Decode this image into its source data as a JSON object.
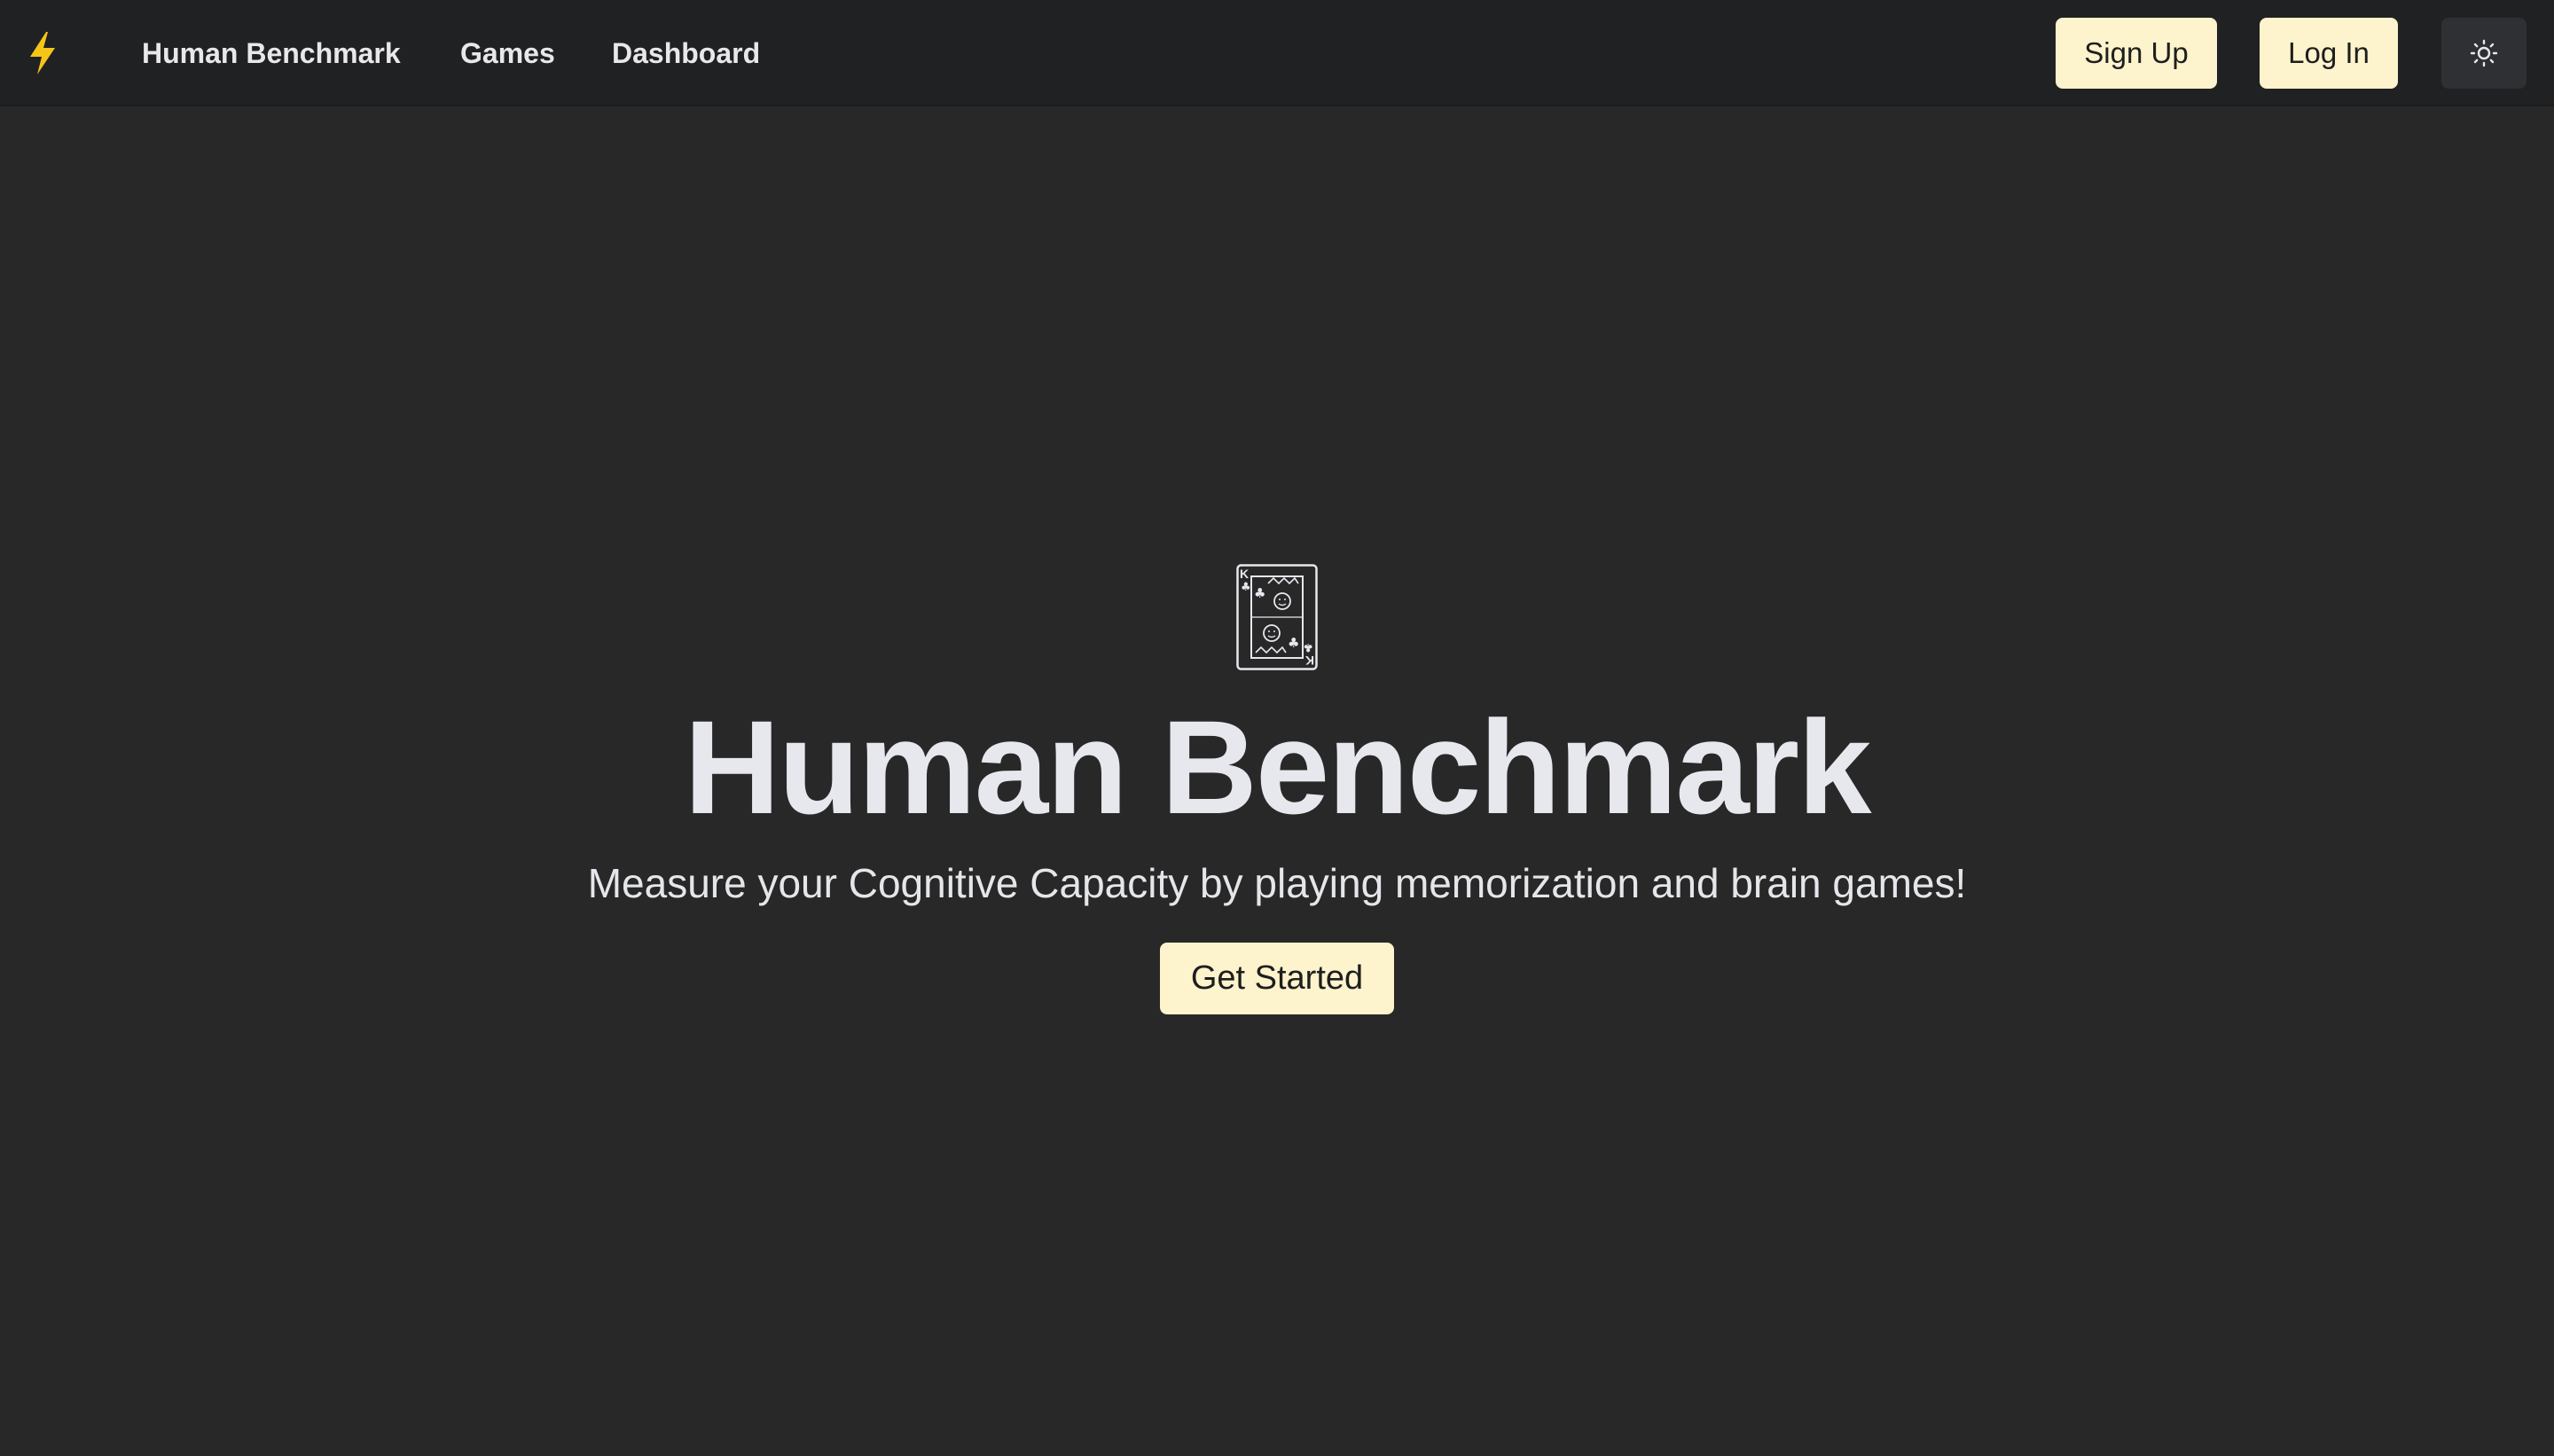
{
  "nav": {
    "logo_icon": "lightning-bolt-icon",
    "links": [
      {
        "label": "Human Benchmark"
      },
      {
        "label": "Games"
      },
      {
        "label": "Dashboard"
      }
    ],
    "signup_label": "Sign Up",
    "login_label": "Log In",
    "theme_toggle_icon": "sun-icon"
  },
  "hero": {
    "icon": "playing-card-king-of-clubs-icon",
    "title": "Human Benchmark",
    "subtitle": "Measure your Cognitive Capacity by playing memorization and brain games!",
    "cta_label": "Get Started"
  },
  "colors": {
    "background": "#282828",
    "navbar": "#202123",
    "button": "#fdf3cc",
    "button_text": "#1e1e1e",
    "logo_bolt": "#f5c518",
    "text": "#e6e8ee"
  }
}
